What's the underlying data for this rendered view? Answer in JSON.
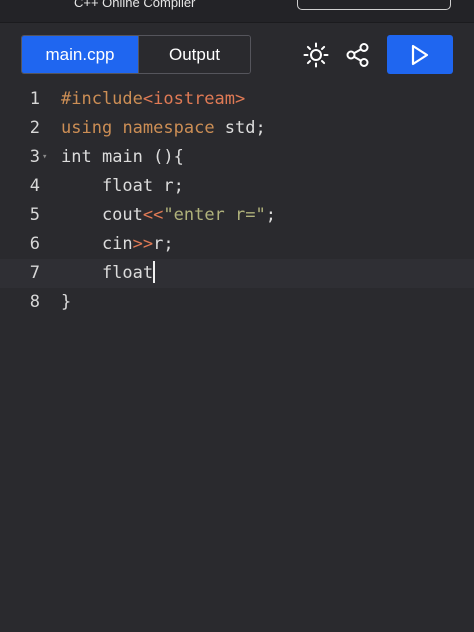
{
  "header": {
    "title": "C++ Online Compiler"
  },
  "toolbar": {
    "tabs": [
      {
        "label": "main.cpp",
        "active": true
      },
      {
        "label": "Output",
        "active": false
      }
    ],
    "icons": [
      "sun-icon",
      "share-icon",
      "play-icon"
    ]
  },
  "editor": {
    "active_line": 7,
    "lines": [
      {
        "num": "1",
        "tokens": [
          {
            "text": "#include",
            "cls": "kw"
          },
          {
            "text": "<iostream>",
            "cls": "op"
          }
        ]
      },
      {
        "num": "2",
        "tokens": [
          {
            "text": "using",
            "cls": "kw"
          },
          {
            "text": " ",
            "cls": "plain"
          },
          {
            "text": "namespace",
            "cls": "kw"
          },
          {
            "text": " std;",
            "cls": "plain"
          }
        ]
      },
      {
        "num": "3",
        "fold": "▾",
        "tokens": [
          {
            "text": "int",
            "cls": "plain"
          },
          {
            "text": " main (){",
            "cls": "plain"
          }
        ]
      },
      {
        "num": "4",
        "tokens": [
          {
            "text": "    float",
            "cls": "plain"
          },
          {
            "text": " r;",
            "cls": "plain"
          }
        ]
      },
      {
        "num": "5",
        "tokens": [
          {
            "text": "    cout",
            "cls": "plain"
          },
          {
            "text": "<<",
            "cls": "op"
          },
          {
            "text": "\"enter r=\"",
            "cls": "str"
          },
          {
            "text": ";",
            "cls": "plain"
          }
        ]
      },
      {
        "num": "6",
        "tokens": [
          {
            "text": "    cin",
            "cls": "plain"
          },
          {
            "text": ">>",
            "cls": "op"
          },
          {
            "text": "r;",
            "cls": "plain"
          }
        ]
      },
      {
        "num": "7",
        "tokens": [
          {
            "text": "    float",
            "cls": "plain"
          }
        ],
        "cursor": true
      },
      {
        "num": "8",
        "tokens": [
          {
            "text": "}",
            "cls": "plain"
          }
        ]
      }
    ]
  },
  "colors": {
    "accent": "#1f66f0",
    "background": "#2a2a2e"
  }
}
